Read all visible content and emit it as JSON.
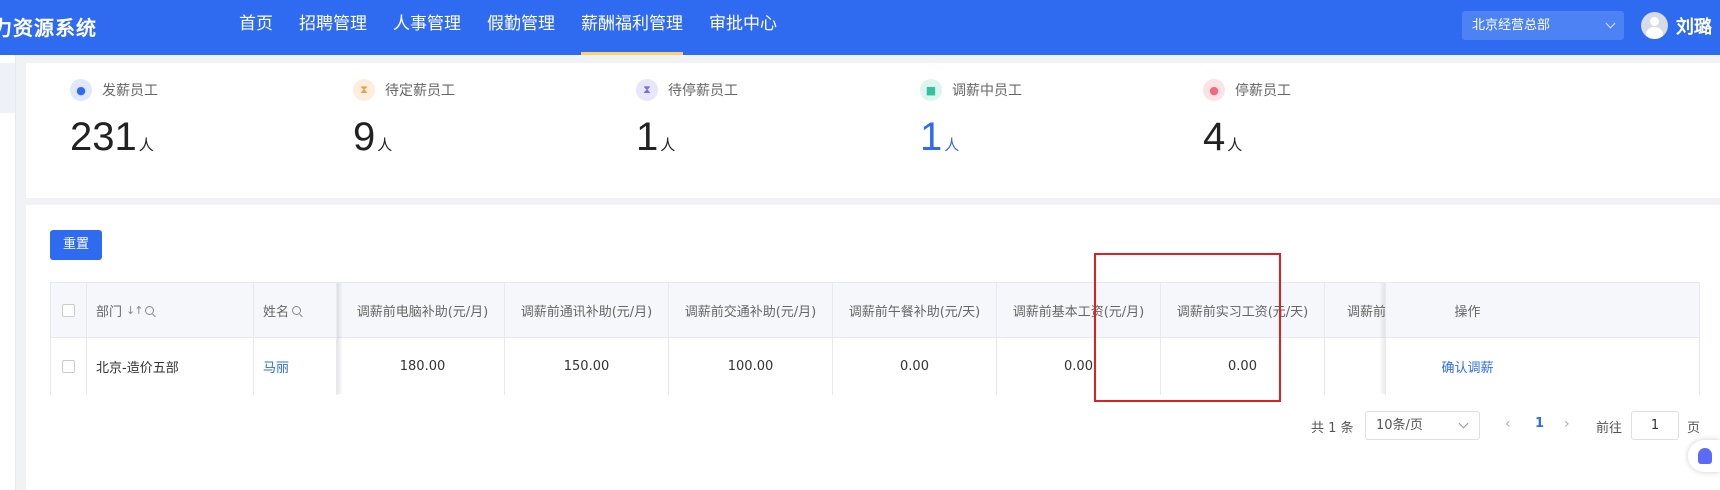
{
  "app": {
    "title": "力资源系统"
  },
  "nav": {
    "items": [
      "首页",
      "招聘管理",
      "人事管理",
      "假勤管理",
      "薪酬福利管理",
      "审批中心"
    ],
    "active_index": 4
  },
  "header": {
    "org_select": "北京经营总部",
    "user_name": "刘璐"
  },
  "stats": [
    {
      "label": "发薪员工",
      "value": "231",
      "unit": "人",
      "icon": "wallet-icon",
      "icon_bg": "#dfe8ff",
      "icon_color": "#2f6bf1"
    },
    {
      "label": "待定薪员工",
      "value": "9",
      "unit": "人",
      "icon": "hourglass-icon",
      "icon_bg": "#fdeede",
      "icon_color": "#f0a04b"
    },
    {
      "label": "待停薪员工",
      "value": "1",
      "unit": "人",
      "icon": "hourglass-icon",
      "icon_bg": "#e8e6fb",
      "icon_color": "#7a6ee6"
    },
    {
      "label": "调薪中员工",
      "value": "1",
      "unit": "人",
      "icon": "adjust-icon",
      "icon_bg": "#dcf5ef",
      "icon_color": "#33c2a0",
      "highlight": true
    },
    {
      "label": "停薪员工",
      "value": "4",
      "unit": "人",
      "icon": "stop-icon",
      "icon_bg": "#fde3e6",
      "icon_color": "#ef6b7d"
    }
  ],
  "toolbar": {
    "reset_label": "重置"
  },
  "table": {
    "columns": [
      "部门",
      "姓名",
      "调薪前电脑补助(元/月)",
      "调薪前通讯补助(元/月)",
      "调薪前交通补助(元/月)",
      "调薪前午餐补助(元/天)",
      "调薪前基本工资(元/月)",
      "调薪前实习工资(元/天)",
      "调薪前",
      "操作"
    ],
    "sort_icon": "↓↑",
    "rows": [
      {
        "dept": "北京-造价五部",
        "name": "马丽",
        "computer": "180.00",
        "telecom": "150.00",
        "transport": "100.00",
        "lunch": "0.00",
        "base": "0.00",
        "intern": "0.00",
        "more": "",
        "action": "确认调薪"
      }
    ]
  },
  "pagination": {
    "total": "共 1 条",
    "page_size": "10条/页",
    "prev": "‹",
    "current": "1",
    "next": "›",
    "goto_label": "前往",
    "goto_value": "1",
    "page_label": "页"
  }
}
